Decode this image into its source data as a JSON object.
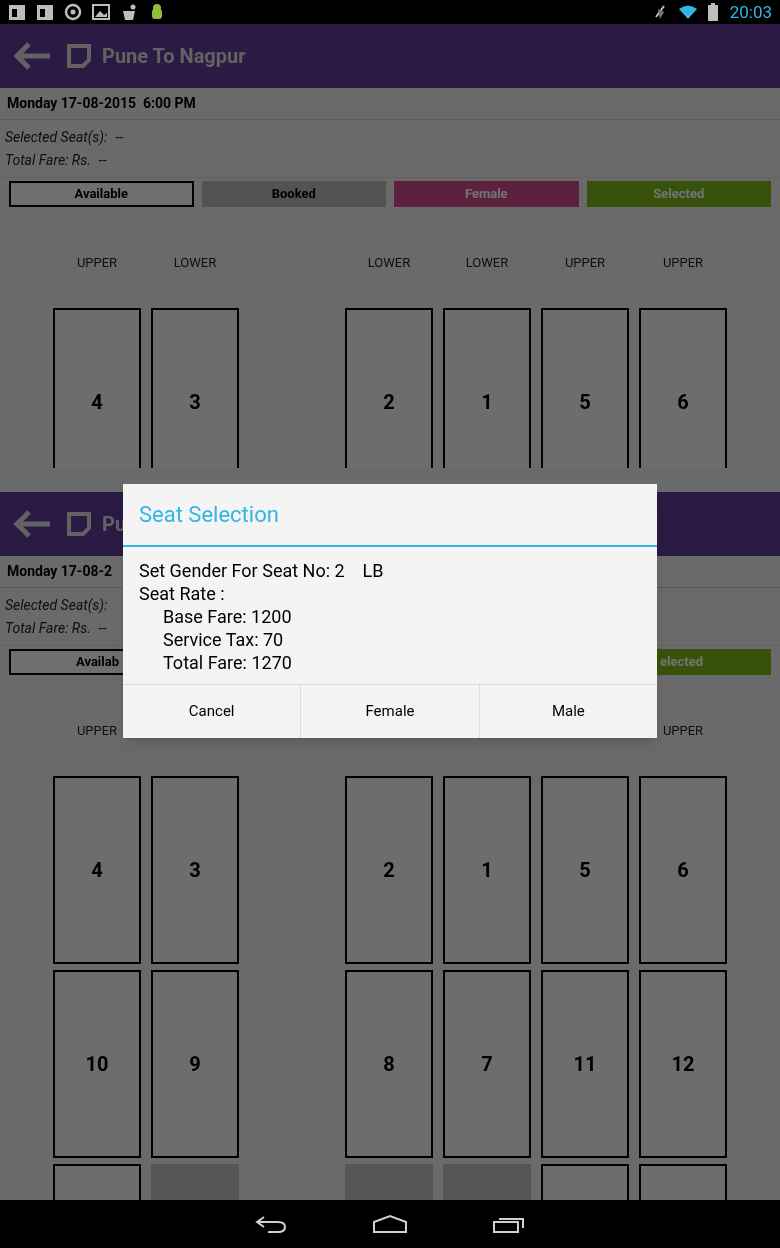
{
  "status_bar": {
    "time": "20:03"
  },
  "screens": [
    {
      "app_bar": {
        "title": "Pune To Nagpur"
      },
      "date": "Monday 17-08-2015  6:00 PM",
      "selected_seats": {
        "label": "Selected Seat(s):",
        "value": "--"
      },
      "total_fare": {
        "label": "Total Fare: Rs.",
        "value": "--"
      },
      "legend": [
        {
          "kind": "available",
          "label": "Available"
        },
        {
          "kind": "booked",
          "label": "Booked"
        },
        {
          "kind": "female",
          "label": "Female"
        },
        {
          "kind": "selected",
          "label": "Selected"
        }
      ],
      "seat_rows": [
        [
          {
            "number": "4",
            "booked": false,
            "deck_label": "UPPER"
          },
          {
            "number": "3",
            "booked": false,
            "deck_label": "LOWER"
          },
          {
            "number": "2",
            "booked": false,
            "deck_label": "LOWER"
          },
          {
            "number": "1",
            "booked": false,
            "deck_label": "LOWER"
          },
          {
            "number": "5",
            "booked": false,
            "deck_label": "UPPER"
          },
          {
            "number": "6",
            "booked": false,
            "deck_label": "UPPER"
          }
        ]
      ]
    },
    {
      "app_bar": {
        "title": "Pu"
      },
      "date": "Monday 17-08-2",
      "selected_seats": {
        "label": "Selected Seat(s):"
      },
      "total_fare": {
        "label": "Total Fare: Rs.",
        "value": "--"
      },
      "legend": [
        {
          "kind": "available",
          "label": "Availab"
        },
        {
          "kind": "selected",
          "label": "elected"
        }
      ],
      "seat_rows": [
        [
          {
            "number": "4",
            "booked": false,
            "deck_label": "UPPER"
          },
          {
            "number": "3",
            "booked": false
          },
          {
            "number": "2",
            "booked": false
          },
          {
            "number": "1",
            "booked": false
          },
          {
            "number": "5",
            "booked": false
          },
          {
            "number": "6",
            "booked": false,
            "deck_label": "UPPER"
          }
        ],
        [
          {
            "number": "10",
            "booked": false
          },
          {
            "number": "9",
            "booked": false
          },
          {
            "number": "8",
            "booked": false
          },
          {
            "number": "7",
            "booked": false
          },
          {
            "number": "11",
            "booked": false
          },
          {
            "number": "12",
            "booked": false
          }
        ],
        [
          {
            "booked": false
          },
          {
            "booked": true
          },
          {
            "booked": true
          },
          {
            "booked": true
          },
          {
            "booked": false
          },
          {
            "booked": false
          }
        ]
      ]
    }
  ],
  "dialog": {
    "title": "Seat Selection",
    "message": "Set Gender For Seat No: 2    LB",
    "seat_rate": {
      "label": "Seat Rate :",
      "children": [
        "Base Fare: 1200",
        "Service Tax: 70",
        "Total Fare: 1270"
      ]
    },
    "buttons": [
      "Cancel",
      "Female",
      "Male"
    ]
  }
}
